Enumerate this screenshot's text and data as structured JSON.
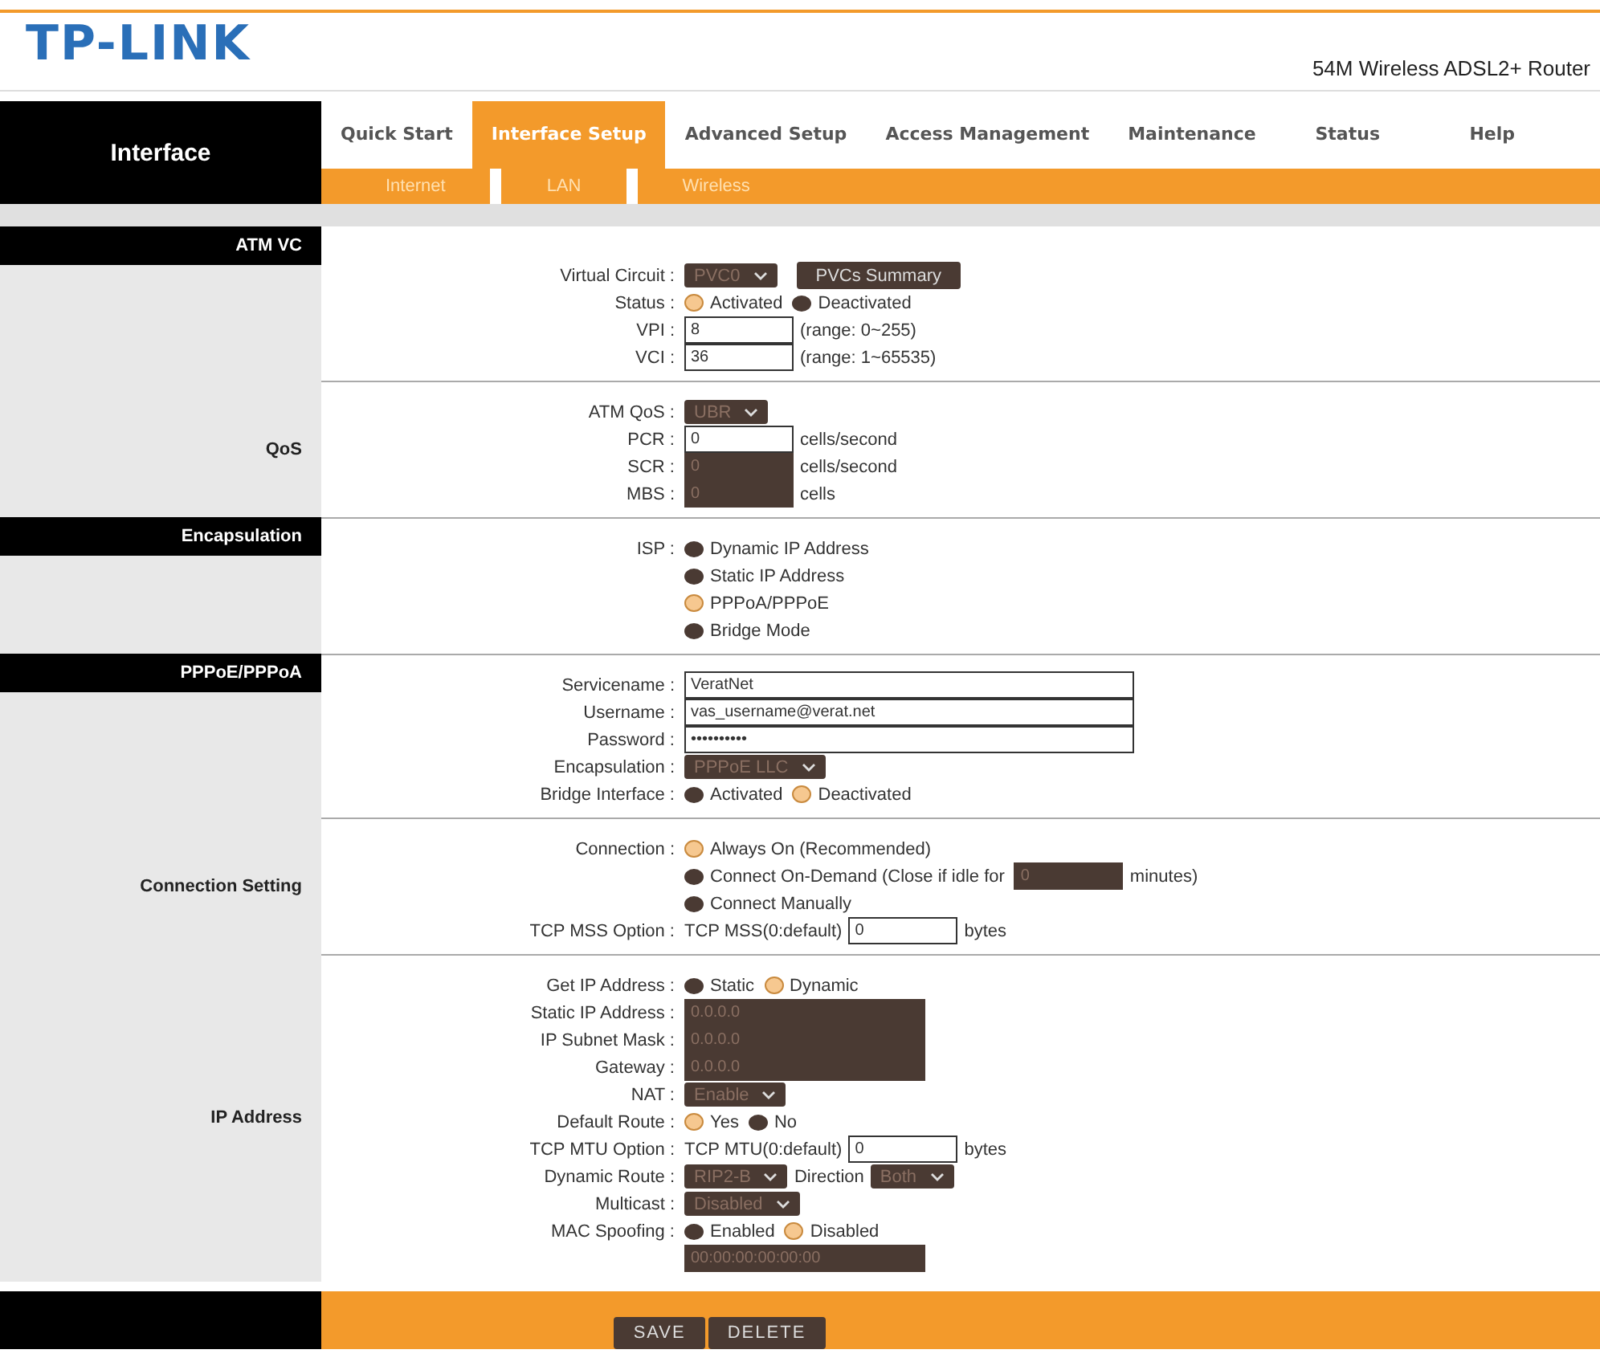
{
  "logo": "TP-LINK",
  "product": "54M Wireless ADSL2+ Router",
  "nav": {
    "section": "Interface",
    "tabs": [
      {
        "label": "Quick Start",
        "selected": false
      },
      {
        "label": "Interface Setup",
        "selected": true
      },
      {
        "label": "Advanced Setup",
        "selected": false
      },
      {
        "label": "Access Management",
        "selected": false
      },
      {
        "label": "Maintenance",
        "selected": false
      },
      {
        "label": "Status",
        "selected": false
      },
      {
        "label": "Help",
        "selected": false
      }
    ],
    "subtabs": [
      "Internet",
      "LAN",
      "Wireless"
    ]
  },
  "sections": [
    {
      "title": "ATM VC",
      "kind": "header",
      "rows": [
        {
          "label": "Virtual Circuit :",
          "controls": [
            {
              "kind": "select",
              "value": "PVC0",
              "disabled": true
            },
            {
              "kind": "button",
              "label": "PVCs Summary"
            }
          ]
        },
        {
          "label": "Status :",
          "controls": [
            {
              "kind": "radio",
              "label": "Activated",
              "selected": true
            },
            {
              "kind": "radio",
              "label": "Deactivated",
              "selected": false
            }
          ]
        },
        {
          "label": "VPI :",
          "controls": [
            {
              "kind": "input",
              "value": "8",
              "disabled": false
            },
            {
              "kind": "text",
              "text": "(range: 0~255)"
            }
          ]
        },
        {
          "label": "VCI :",
          "controls": [
            {
              "kind": "input",
              "value": "36",
              "disabled": false
            },
            {
              "kind": "text",
              "text": "(range: 1~65535)"
            }
          ]
        }
      ]
    },
    {
      "title": "QoS",
      "kind": "label",
      "rows": [
        {
          "label": "ATM QoS :",
          "controls": [
            {
              "kind": "select",
              "value": "UBR",
              "disabled": true
            }
          ]
        },
        {
          "label": "PCR :",
          "controls": [
            {
              "kind": "input",
              "value": "0",
              "disabled": false
            },
            {
              "kind": "text",
              "text": "cells/second"
            }
          ]
        },
        {
          "label": "SCR :",
          "controls": [
            {
              "kind": "input",
              "value": "0",
              "disabled": true
            },
            {
              "kind": "text",
              "text": "cells/second"
            }
          ]
        },
        {
          "label": "MBS :",
          "controls": [
            {
              "kind": "input",
              "value": "0",
              "disabled": true
            },
            {
              "kind": "text",
              "text": "cells"
            }
          ]
        }
      ]
    },
    {
      "title": "Encapsulation",
      "kind": "header",
      "rows": [
        {
          "label": "ISP :",
          "controls": [
            {
              "kind": "radio",
              "label": "Dynamic IP Address",
              "selected": false
            }
          ]
        },
        {
          "controls": [
            {
              "kind": "radio",
              "label": "Static IP Address",
              "selected": false
            }
          ]
        },
        {
          "controls": [
            {
              "kind": "radio",
              "label": "PPPoA/PPPoE",
              "selected": true
            }
          ]
        },
        {
          "controls": [
            {
              "kind": "radio",
              "label": "Bridge Mode",
              "selected": false
            }
          ]
        }
      ]
    },
    {
      "title": "PPPoE/PPPoA",
      "kind": "header",
      "rows": [
        {
          "label": "Servicename :",
          "controls": [
            {
              "kind": "wide_input",
              "value": "VeratNet",
              "disabled": false
            }
          ]
        },
        {
          "label": "Username :",
          "controls": [
            {
              "kind": "wide_input",
              "value": "vas_username@verat.net",
              "disabled": false
            }
          ]
        },
        {
          "label": "Password :",
          "controls": [
            {
              "kind": "wide_input",
              "value": "••••••••••",
              "disabled": false
            }
          ]
        },
        {
          "label": "Encapsulation :",
          "controls": [
            {
              "kind": "select",
              "value": "PPPoE LLC",
              "disabled": true
            }
          ]
        },
        {
          "label": "Bridge Interface :",
          "controls": [
            {
              "kind": "radio",
              "label": "Activated",
              "selected": false
            },
            {
              "kind": "radio",
              "label": "Deactivated",
              "selected": true
            }
          ]
        }
      ]
    },
    {
      "title": "Connection Setting",
      "kind": "label",
      "rows": [
        {
          "label": "Connection :",
          "controls": [
            {
              "kind": "radio",
              "label": "Always On (Recommended)",
              "selected": true
            }
          ]
        },
        {
          "controls": [
            {
              "kind": "radio",
              "label": "Connect On-Demand (Close if idle for",
              "selected": false
            },
            {
              "kind": "input",
              "value": "0",
              "disabled": true
            },
            {
              "kind": "text",
              "text": "minutes)"
            }
          ]
        },
        {
          "controls": [
            {
              "kind": "radio",
              "label": "Connect Manually",
              "selected": false
            }
          ]
        },
        {
          "label": "TCP MSS Option :",
          "controls": [
            {
              "kind": "text",
              "text": "TCP MSS(0:default)"
            },
            {
              "kind": "input",
              "value": "0",
              "disabled": false
            },
            {
              "kind": "text",
              "text": "bytes"
            }
          ]
        }
      ]
    },
    {
      "title": "IP Address",
      "kind": "label",
      "rows": [
        {
          "label": "Get IP Address :",
          "controls": [
            {
              "kind": "radio",
              "label": "Static",
              "selected": false
            },
            {
              "kind": "radio",
              "label": "Dynamic",
              "selected": true
            }
          ]
        },
        {
          "label": "Static IP Address :",
          "controls": [
            {
              "kind": "address_input",
              "value": "0.0.0.0",
              "disabled": true
            }
          ]
        },
        {
          "label": "IP Subnet Mask :",
          "controls": [
            {
              "kind": "address_input",
              "value": "0.0.0.0",
              "disabled": true
            }
          ]
        },
        {
          "label": "Gateway :",
          "controls": [
            {
              "kind": "address_input",
              "value": "0.0.0.0",
              "disabled": true
            }
          ]
        },
        {
          "label": "NAT :",
          "controls": [
            {
              "kind": "select",
              "value": "Enable",
              "disabled": true
            }
          ]
        },
        {
          "label": "Default Route :",
          "controls": [
            {
              "kind": "radio",
              "label": "Yes",
              "selected": true
            },
            {
              "kind": "radio",
              "label": "No",
              "selected": false
            }
          ]
        },
        {
          "label": "TCP MTU Option :",
          "controls": [
            {
              "kind": "text",
              "text": "TCP MTU(0:default)"
            },
            {
              "kind": "input",
              "value": "0",
              "disabled": false
            },
            {
              "kind": "text",
              "text": "bytes"
            }
          ]
        },
        {
          "label": "Dynamic Route :",
          "controls": [
            {
              "kind": "select",
              "value": "RIP2-B",
              "disabled": true
            },
            {
              "kind": "text",
              "text": "Direction"
            },
            {
              "kind": "select",
              "value": "Both",
              "disabled": true
            }
          ]
        },
        {
          "label": "Multicast :",
          "controls": [
            {
              "kind": "select",
              "value": "Disabled",
              "disabled": true
            }
          ]
        },
        {
          "label": "MAC Spoofing :",
          "controls": [
            {
              "kind": "radio",
              "label": "Enabled",
              "selected": false
            },
            {
              "kind": "radio",
              "label": "Disabled",
              "selected": true
            }
          ]
        },
        {
          "controls": [
            {
              "kind": "address_input",
              "value": "00:00:00:00:00:00",
              "disabled": true
            }
          ]
        }
      ]
    }
  ],
  "footer_buttons": [
    "SAVE",
    "DELETE"
  ]
}
